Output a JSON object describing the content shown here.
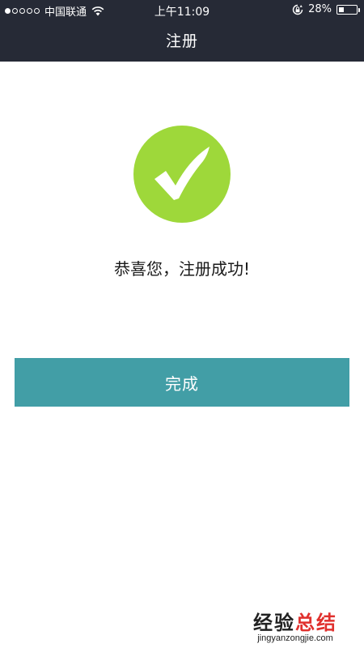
{
  "status_bar": {
    "carrier": "中国联通",
    "time": "上午11:09",
    "battery_percent": "28%",
    "battery_level": 0.28
  },
  "nav": {
    "title": "注册"
  },
  "main": {
    "success_icon": "checkmark-icon",
    "message": "恭喜您，注册成功!",
    "done_button_label": "完成"
  },
  "colors": {
    "header_bg": "#262a36",
    "success_green": "#9ed83a",
    "button_teal": "#429ea6",
    "watermark_red": "#e0302d"
  },
  "watermark": {
    "brand_black": "经验",
    "brand_red": "总结",
    "url": "jingyanzongjie.com"
  }
}
